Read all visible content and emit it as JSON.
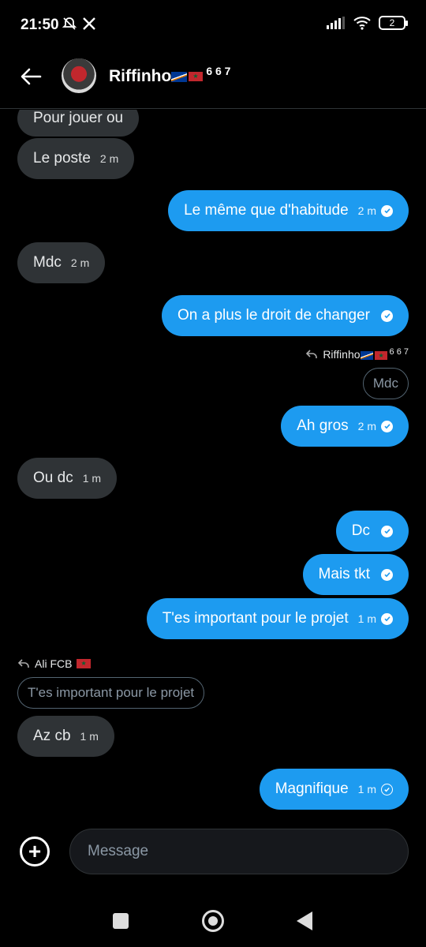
{
  "status": {
    "time": "21:50",
    "battery": "2"
  },
  "header": {
    "contact_name": "Riffinho",
    "contact_suffix": "6 6 7"
  },
  "messages": [
    {
      "dir": "in",
      "text": "Pour jouer ou",
      "time": ""
    },
    {
      "dir": "in",
      "text": "Le poste",
      "time": "2 m"
    },
    {
      "dir": "out",
      "text": "Le même que d'habitude",
      "time": "2 m",
      "status": "read"
    },
    {
      "dir": "in",
      "text": "Mdc",
      "time": "2 m"
    },
    {
      "dir": "out",
      "text": "On a plus le droit de changer",
      "time": "",
      "status": "read"
    },
    {
      "dir": "out",
      "text": "Ah gros",
      "time": "2 m",
      "status": "read",
      "reply_to": "Riffinho",
      "quoted": "Mdc"
    },
    {
      "dir": "in",
      "text": "Ou dc",
      "time": "1 m"
    },
    {
      "dir": "out",
      "text": "Dc",
      "time": "",
      "status": "read"
    },
    {
      "dir": "out",
      "text": "Mais tkt",
      "time": "",
      "status": "read"
    },
    {
      "dir": "out",
      "text": "T'es important pour le projet",
      "time": "1 m",
      "status": "read"
    },
    {
      "dir": "in",
      "text": "Az cb",
      "time": "1 m",
      "reply_to": "Ali FCB",
      "quoted": "T'es important pour le projet"
    },
    {
      "dir": "out",
      "text": "Magnifique",
      "time": "1 m",
      "status": "sent"
    }
  ],
  "reply_labels": {
    "riffinho": "Riffinho",
    "riffinho_suffix": "6 6 7",
    "ali": "Ali FCB"
  },
  "composer": {
    "placeholder": "Message"
  },
  "icons": {
    "back": "arrow-left-icon",
    "add": "plus-circle-icon",
    "reply": "reply-arrow-icon",
    "read": "check-circle-icon"
  },
  "colors": {
    "outgoing": "#1d9bf0",
    "incoming": "#2f3336",
    "background": "#000000"
  }
}
